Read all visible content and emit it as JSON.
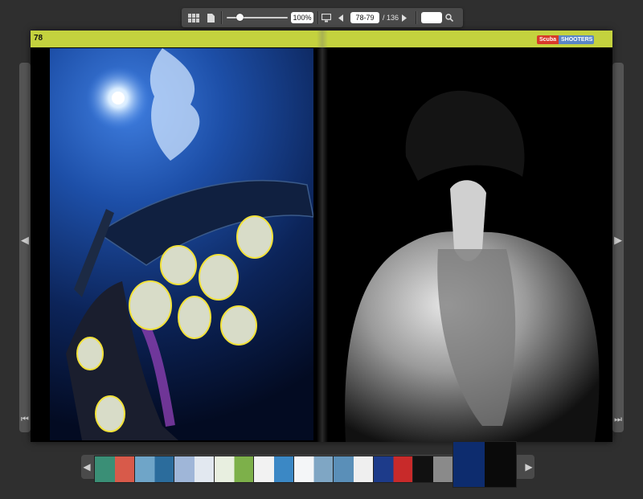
{
  "toolbar": {
    "zoom_value": "100%",
    "page_value": "78-79",
    "page_total": "/ 136",
    "search_value": ""
  },
  "page": {
    "left_page_number": "78",
    "logo_part1": "Scuba",
    "logo_part2": "SHOOTERS"
  },
  "icons": {
    "thumbnails_view": "grid-icon",
    "single_page": "page-icon",
    "fullscreen": "monitor-icon",
    "prev": "triangle-left-icon",
    "next": "triangle-right-icon",
    "search": "magnifier-icon"
  },
  "colors": {
    "header_bar": "#c4d23e",
    "background": "#2f2f2f",
    "toolbar": "#4a4a4a"
  },
  "thumbnails": [
    {
      "colors": [
        "#3a8f76",
        "#d85a4a"
      ]
    },
    {
      "colors": [
        "#6fa5c8",
        "#2b6c9c"
      ]
    },
    {
      "colors": [
        "#9fb6d8",
        "#e2e8f0"
      ]
    },
    {
      "colors": [
        "#e8efe0",
        "#7db04a"
      ]
    },
    {
      "colors": [
        "#f2f2f2",
        "#3b88c5"
      ]
    },
    {
      "colors": [
        "#f4f6f8",
        "#7fa6c4"
      ]
    },
    {
      "colors": [
        "#5a8fb8",
        "#efefef"
      ]
    },
    {
      "colors": [
        "#1d3b8a",
        "#c82a2a"
      ]
    },
    {
      "colors": [
        "#111111",
        "#8a8a8a"
      ]
    },
    {
      "colors": [
        "#0d2c6e",
        "#0a0a0a"
      ]
    }
  ]
}
